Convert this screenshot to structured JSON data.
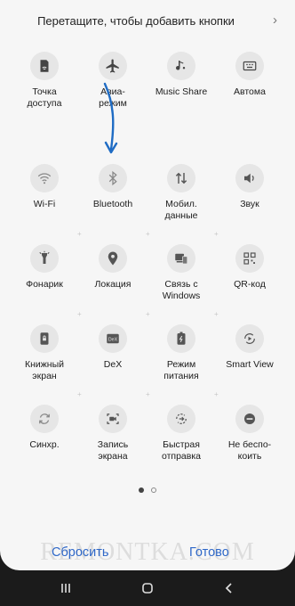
{
  "header": {
    "hint": "Перетащите, чтобы добавить кнопки",
    "chevron": "›"
  },
  "top_row": [
    {
      "label": "Точка\nдоступа",
      "icon": "hotspot-icon"
    },
    {
      "label": "Авиа-\nрежим",
      "icon": "airplane-icon"
    },
    {
      "label": "Music Share",
      "icon": "music-share-icon"
    },
    {
      "label": "Автома",
      "icon": "keyboard-icon"
    }
  ],
  "tiles": [
    {
      "label": "Wi-Fi",
      "icon": "wifi-icon"
    },
    {
      "label": "Bluetooth",
      "icon": "bluetooth-icon"
    },
    {
      "label": "Мобил.\nданные",
      "icon": "mobile-data-icon"
    },
    {
      "label": "Звук",
      "icon": "sound-icon"
    },
    {
      "label": "Фонарик",
      "icon": "flashlight-icon"
    },
    {
      "label": "Локация",
      "icon": "location-icon"
    },
    {
      "label": "Связь с\nWindows",
      "icon": "link-windows-icon"
    },
    {
      "label": "QR-код",
      "icon": "qr-icon"
    },
    {
      "label": "Книжный\nэкран",
      "icon": "portrait-lock-icon"
    },
    {
      "label": "DeX",
      "icon": "dex-icon"
    },
    {
      "label": "Режим\nпитания",
      "icon": "power-mode-icon"
    },
    {
      "label": "Smart View",
      "icon": "smart-view-icon"
    },
    {
      "label": "Синхр.",
      "icon": "sync-icon"
    },
    {
      "label": "Запись\nэкрана",
      "icon": "screen-record-icon"
    },
    {
      "label": "Быстрая\nотправка",
      "icon": "quick-share-icon"
    },
    {
      "label": "Не беспо-\nкоить",
      "icon": "dnd-icon"
    }
  ],
  "pager": {
    "pages": 2,
    "current": 1
  },
  "footer": {
    "reset": "Сбросить",
    "done": "Готово"
  },
  "watermark": "REMONTKA.COM",
  "colors": {
    "accent": "#2f68c8",
    "arrow": "#1f6cc4",
    "tile_bg": "#e6e6e6",
    "screen_bg": "#f6f6f6"
  }
}
